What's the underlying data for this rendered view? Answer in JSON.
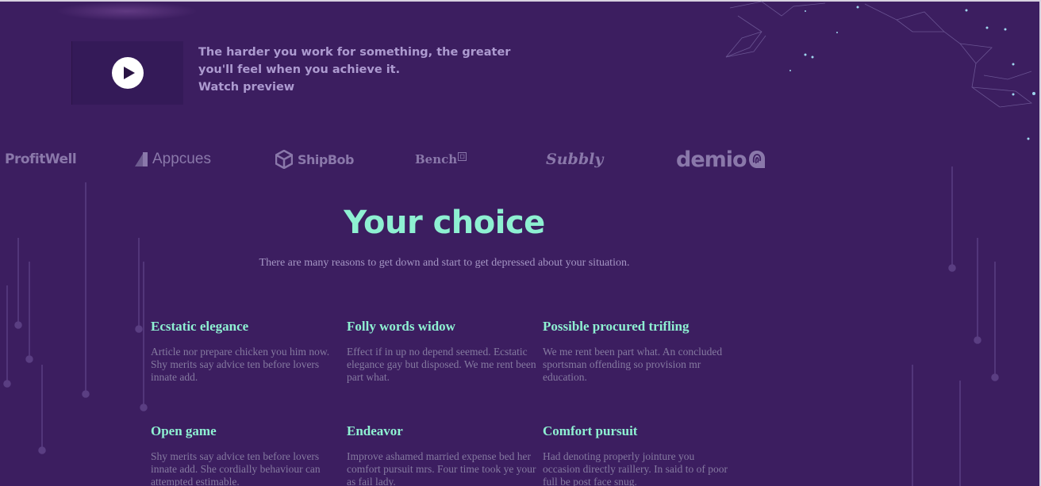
{
  "hero": {
    "quote_line1": "The harder you work for something, the greater",
    "quote_line2": "you'll feel when you achieve it.",
    "watch_label": "Watch preview"
  },
  "logos": {
    "profitwell": "ProfitWell",
    "appcues": "Appcues",
    "shipbob": "ShipBob",
    "bench": "Bench",
    "subbly": "Subbly",
    "demio": "demio"
  },
  "section": {
    "title": "Your choice",
    "subtitle": "There are many reasons to get down and start to get depressed about your situation."
  },
  "features": [
    {
      "title": "Ecstatic elegance",
      "text": "Article nor prepare chicken you him now. Shy merits say advice ten before lovers innate add."
    },
    {
      "title": "Folly words widow",
      "text": "Effect if in up no depend seemed. Ecstatic elegance gay but disposed. We me rent been part what."
    },
    {
      "title": "Possible procured trifling",
      "text": "We me rent been part what. An concluded sportsman offending so provision mr education."
    },
    {
      "title": "Open game",
      "text": "Shy merits say advice ten before lovers innate add. She cordially behaviour can attempted estimable."
    },
    {
      "title": "Endeavor",
      "text": "Improve ashamed married expense bed her comfort pursuit mrs. Four time took ye your as fail lady."
    },
    {
      "title": "Comfort pursuit",
      "text": "Had denoting properly jointure you occasion directly raillery. In said to of poor full be post face snug."
    }
  ],
  "colors": {
    "background": "#3c1e60",
    "accent": "#8ef0d2",
    "muted_text": "#857aa0",
    "logo": "#8a78aa"
  },
  "icons": {
    "play": "play-icon",
    "appcues": "appcues-mark-icon",
    "shipbob": "shipbob-cube-icon",
    "demio": "demio-fingerprint-icon"
  }
}
